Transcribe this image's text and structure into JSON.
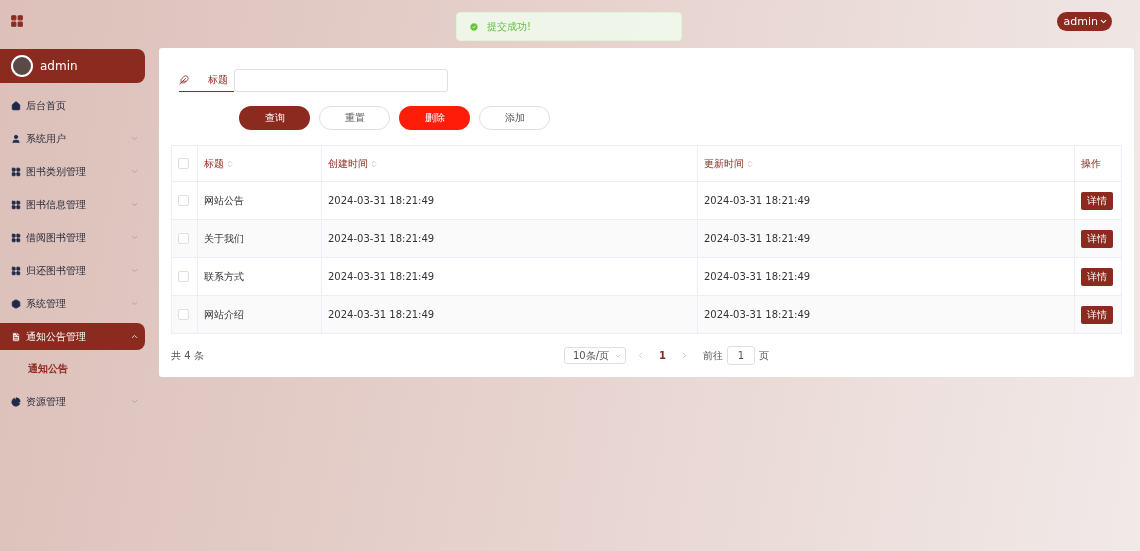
{
  "header": {
    "user_menu": "admin"
  },
  "toast": {
    "message": "提交成功!"
  },
  "sidebar": {
    "user": "admin",
    "items": [
      {
        "label": "后台首页",
        "expandable": false,
        "expanded": false,
        "selected": false
      },
      {
        "label": "系统用户",
        "expandable": true,
        "expanded": false,
        "selected": false
      },
      {
        "label": "图书类别管理",
        "expandable": true,
        "expanded": false,
        "selected": false
      },
      {
        "label": "图书信息管理",
        "expandable": true,
        "expanded": false,
        "selected": false
      },
      {
        "label": "借阅图书管理",
        "expandable": true,
        "expanded": false,
        "selected": false
      },
      {
        "label": "归还图书管理",
        "expandable": true,
        "expanded": false,
        "selected": false
      },
      {
        "label": "系统管理",
        "expandable": true,
        "expanded": false,
        "selected": false
      },
      {
        "label": "通知公告管理",
        "expandable": true,
        "expanded": true,
        "selected": true,
        "children": [
          {
            "label": "通知公告",
            "selected": true
          }
        ]
      },
      {
        "label": "资源管理",
        "expandable": true,
        "expanded": false,
        "selected": false
      }
    ]
  },
  "search": {
    "label": "标题"
  },
  "buttons": [
    {
      "label": "查询",
      "kind": "primary"
    },
    {
      "label": "重置",
      "kind": "plain"
    },
    {
      "label": "删除",
      "kind": "danger"
    },
    {
      "label": "添加",
      "kind": "plain"
    }
  ],
  "table": {
    "all_checked": false,
    "columns": [
      {
        "label": "标题",
        "sortable": true
      },
      {
        "label": "创建时间",
        "sortable": true
      },
      {
        "label": "更新时间",
        "sortable": true
      },
      {
        "label": "操作",
        "sortable": false
      }
    ],
    "rows": [
      {
        "checked": false,
        "title": "网站公告",
        "created": "2024-03-31 18:21:49",
        "updated": "2024-03-31 18:21:49",
        "action": "详情"
      },
      {
        "checked": false,
        "title": "关于我们",
        "created": "2024-03-31 18:21:49",
        "updated": "2024-03-31 18:21:49",
        "action": "详情"
      },
      {
        "checked": false,
        "title": "联系方式",
        "created": "2024-03-31 18:21:49",
        "updated": "2024-03-31 18:21:49",
        "action": "详情"
      },
      {
        "checked": false,
        "title": "网站介绍",
        "created": "2024-03-31 18:21:49",
        "updated": "2024-03-31 18:21:49",
        "action": "详情"
      }
    ]
  },
  "pagination": {
    "total": "共 4 条",
    "page_size": "10条/页",
    "pages": [
      {
        "label": "1",
        "selected": true
      }
    ],
    "goto_label": "前往",
    "goto_value": "1",
    "goto_suffix": "页"
  }
}
